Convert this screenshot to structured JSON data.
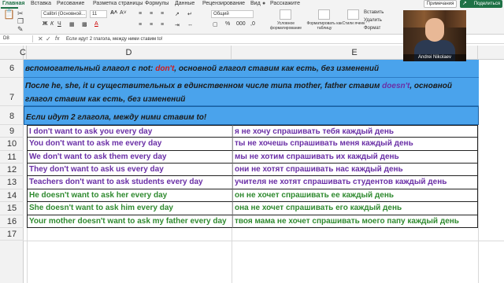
{
  "ribbon_tabs": [
    "Главная",
    "Вставка",
    "Рисование",
    "Разметка страницы",
    "Формулы",
    "Данные",
    "Рецензирование",
    "Вид",
    "Расскажите"
  ],
  "tell_icon": "lightbulb-icon",
  "buttons": {
    "notes": "Примечания",
    "share": "Поделиться"
  },
  "ribbon": {
    "font_name": "Calibri (Основной...",
    "font_size": "11",
    "number_format": "Общий",
    "cond_format": "Условное форматирование",
    "format_table": "Форматировать как таблицу",
    "cell_styles": "Стили ячеек",
    "insert": "Вставить",
    "delete": "Удалить",
    "format": "Формат"
  },
  "formula_bar": {
    "name_box": "D8",
    "fx_label": "fx",
    "content": "Если идут 2 глагола, между ними ставим to!"
  },
  "columns": [
    "C",
    "D",
    "E"
  ],
  "rows": {
    "r6": {
      "num": "6",
      "text_a": "вспомогательный глагол с not:",
      "highlight": "don't",
      "text_b": ", основной глагол ставим как есть, без изменений"
    },
    "r7": {
      "num": "7",
      "line1_a": "После he, she, it и существительных в единственном числе типа mother, father ставим",
      "highlight": "doesn't",
      "line1_b": ", основной",
      "line2": "глагол ставим как есть, без изменений"
    },
    "r8": {
      "num": "8",
      "text": "Если идут 2 глагола, между ними ставим to!"
    }
  },
  "table_rows": [
    {
      "num": "9",
      "en": "I don't want to ask you every day",
      "ru": "я не хочу спрашивать тебя каждый день",
      "color": "#6a2fa6"
    },
    {
      "num": "10",
      "en": "You don't want to ask me every day",
      "ru": "ты не хочешь спрашивать меня каждый день",
      "color": "#6a2fa6"
    },
    {
      "num": "11",
      "en": "We don't want to ask them every day",
      "ru": "мы не хотим спрашивать их каждый день",
      "color": "#6a2fa6"
    },
    {
      "num": "12",
      "en": "They don't want to ask us every day",
      "ru": "они не хотят спрашивать нас каждый день",
      "color": "#6a2fa6"
    },
    {
      "num": "13",
      "en": "Teachers don't want to ask students every day",
      "ru": "учителя не хотят спрашивать студентов каждый день",
      "color": "#6a2fa6"
    },
    {
      "num": "14",
      "en": "He doesn't want to ask her every day",
      "ru": "он не хочет спрашивать ее каждый день",
      "color": "#2f8a2f"
    },
    {
      "num": "15",
      "en": "She doesn't want to ask him every day",
      "ru": "она не хочет спрашивать его каждый день",
      "color": "#2f8a2f"
    },
    {
      "num": "16",
      "en": "Your mother doesn't want to ask my father every day",
      "ru": "твоя мама не хочет спрашивать моего папу каждый день",
      "color": "#2f8a2f"
    }
  ],
  "empty_rows": [
    "17"
  ],
  "webcam": {
    "name": "Andrei Nikolaev"
  },
  "colors": {
    "accent": "#1e7145",
    "band": "#4aa3ec",
    "purple": "#6a2fa6",
    "green": "#2f8a2f",
    "red": "#d11a1a"
  }
}
